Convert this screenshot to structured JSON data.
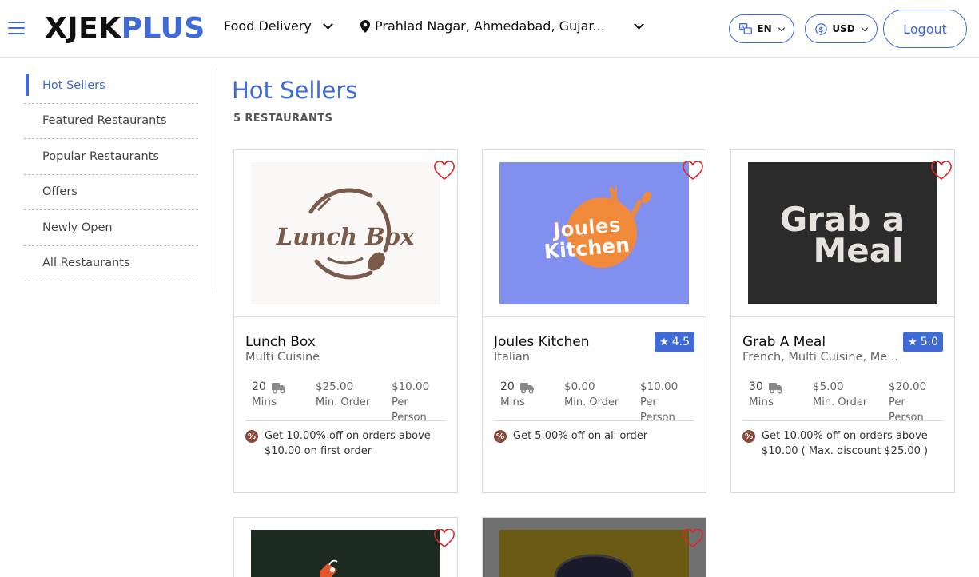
{
  "header": {
    "logo_part1": "XJEK",
    "logo_part2": "PLUS",
    "service": "Food Delivery",
    "location": "Prahlad Nagar, Ahmedabad, Gujar...",
    "language": "EN",
    "currency": "USD",
    "logout_label": "Logout"
  },
  "sidebar": {
    "items": [
      {
        "label": "Hot Sellers",
        "active": true
      },
      {
        "label": "Featured Restaurants",
        "active": false
      },
      {
        "label": "Popular Restaurants",
        "active": false
      },
      {
        "label": "Offers",
        "active": false
      },
      {
        "label": "Newly Open",
        "active": false
      },
      {
        "label": "All Restaurants",
        "active": false
      }
    ]
  },
  "main": {
    "title": "Hot Sellers",
    "count": "5 RESTAURANTS",
    "restaurants": [
      {
        "name": "Lunch Box",
        "cuisine": "Multi Cuisine",
        "rating": "",
        "time_value": "20",
        "time_unit": "Mins",
        "min_order": "$25.00",
        "min_order_label": "Min. Order",
        "per_person": "$10.00",
        "per_person_label": "Per Person",
        "offer": "Get 10.00% off on orders above $10.00 on first order",
        "logo_text": "Lunch Box",
        "logo_bg": "#f9f8f6",
        "logo_color": "#7a5a48"
      },
      {
        "name": "Joules Kitchen",
        "cuisine": "Italian",
        "rating": "4.5",
        "time_value": "20",
        "time_unit": "Mins",
        "min_order": "$0.00",
        "min_order_label": "Min. Order",
        "per_person": "$10.00",
        "per_person_label": "Per Person",
        "offer": "Get 5.00% off on all order",
        "logo_text_1": "Joules",
        "logo_text_2": "Kitchen",
        "logo_bg": "#8190ef",
        "logo_color": "#f08a3a"
      },
      {
        "name": "Grab A Meal",
        "cuisine": "French, Multi Cuisine, Me...",
        "rating": "5.0",
        "time_value": "30",
        "time_unit": "Mins",
        "min_order": "$5.00",
        "min_order_label": "Min. Order",
        "per_person": "$20.00",
        "per_person_label": "Per Person",
        "offer": "Get 10.00% off on orders above $10.00 ( Max. discount $25.00 )",
        "logo_text_1": "Grab a",
        "logo_text_2": "Meal",
        "logo_bg": "#2b2b2b",
        "logo_color": "#e6e3de"
      }
    ],
    "partial_cards": [
      {
        "logo_bg": "#1c2b22"
      },
      {
        "logo_bg": "#6b5a14"
      }
    ]
  },
  "colors": {
    "accent": "#3f6bd9",
    "heart": "#e0242a",
    "offer_badge": "#8b4a3c"
  }
}
